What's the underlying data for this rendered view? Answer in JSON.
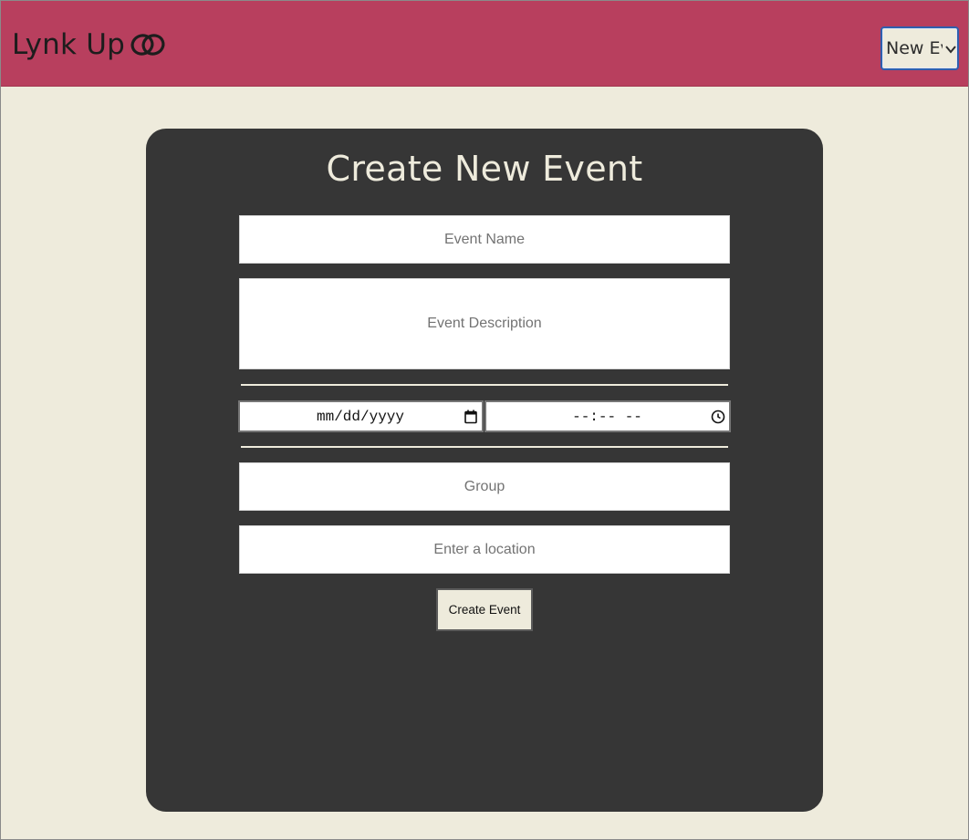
{
  "header": {
    "brand_name": "Lynk Up",
    "brand_icon": "linked-rings-icon",
    "nav_select": {
      "selected_value": "New Event",
      "visible_text": "New Ev"
    }
  },
  "form": {
    "title": "Create New Event",
    "event_name_placeholder": "Event Name",
    "event_description_placeholder": "Event Description",
    "date_placeholder": "mm/dd/yyyy",
    "date_icon": "calendar-icon",
    "time_placeholder": "--:-- --",
    "time_icon": "clock-icon",
    "group_placeholder": "Group",
    "location_placeholder": "Enter a location",
    "submit_label": "Create Event"
  },
  "colors": {
    "header_bg": "#b83f5e",
    "page_bg": "#eeebdc",
    "card_bg": "#363636",
    "accent_text": "#eeebdc"
  }
}
